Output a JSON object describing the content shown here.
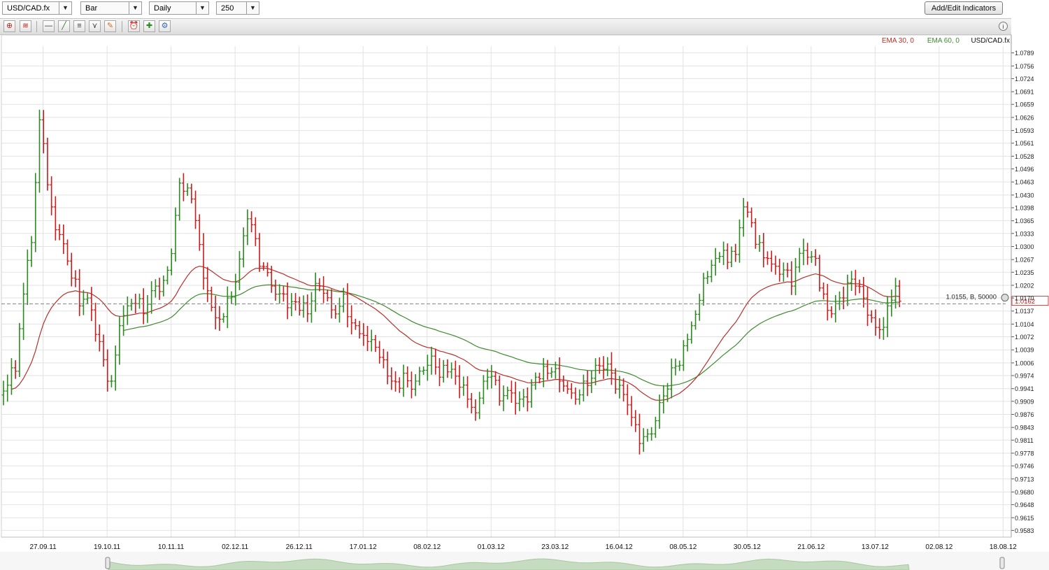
{
  "toolbar": {
    "symbol": "USD/CAD.fx",
    "chart_style": "Bar",
    "period": "Daily",
    "bars": "250",
    "add_indicators_label": "Add/Edit Indicators",
    "tools": [
      "crosshair-icon",
      "chart-type-icon",
      "horizontal-line-icon",
      "trend-line-icon",
      "fibonacci-icon",
      "pitchfork-icon",
      "eraser-icon",
      "alarm-clock-icon",
      "add-order-icon",
      "settings-gear-icon"
    ]
  },
  "legend": {
    "ema30": "EMA 30, 0",
    "ema60": "EMA 60, 0",
    "symbol": "USD/CAD.fx"
  },
  "colors": {
    "up": "#2a8a1e",
    "down": "#cc1b1b",
    "ema30": "#b8302a",
    "ema60": "#3d8b2f",
    "grid": "#e2e2e2",
    "position_line": "#888888",
    "price_label_bg": "#ffffff",
    "price_label_text": "#cc1b1b"
  },
  "position": {
    "label": "1.0155, B, 50000",
    "price": 1.0155
  },
  "current_price_label": "1.0162",
  "chart_data": {
    "type": "ohlc-bar",
    "title": "",
    "ylim": [
      0.9566,
      1.0806
    ],
    "y_ticks": [
      "1.0789",
      "1.0756",
      "1.0724",
      "1.0691",
      "1.0659",
      "1.0626",
      "1.0593",
      "1.0561",
      "1.0528",
      "1.0496",
      "1.0463",
      "1.0430",
      "1.0398",
      "1.0365",
      "1.0333",
      "1.0300",
      "1.0267",
      "1.0235",
      "1.0202",
      "1.0170",
      "1.0137",
      "1.0104",
      "1.0072",
      "1.0039",
      "1.0006",
      "0.9974",
      "0.9941",
      "0.9909",
      "0.9876",
      "0.9843",
      "0.9811",
      "0.9778",
      "0.9746",
      "0.9713",
      "0.9680",
      "0.9648",
      "0.9615",
      "0.9583"
    ],
    "x_ticks": [
      "27.09.11",
      "19.10.11",
      "10.11.11",
      "02.12.11",
      "26.12.11",
      "17.01.12",
      "08.02.12",
      "01.03.12",
      "23.03.12",
      "16.04.12",
      "08.05.12",
      "30.05.12",
      "21.06.12",
      "13.07.12",
      "02.08.12",
      "18.08.12"
    ],
    "x_tick_bar_index": [
      5,
      21,
      37,
      53,
      69,
      85,
      101,
      117,
      133,
      149,
      165,
      181,
      197,
      213,
      229,
      245
    ],
    "grid": true,
    "series": [
      {
        "name": "EMA 30, 0",
        "color": "#b8302a"
      },
      {
        "name": "EMA 60, 0",
        "color": "#3d8b2f"
      }
    ],
    "anchors": [
      [
        0,
        0.9935
      ],
      [
        3,
        0.9985
      ],
      [
        5,
        1.018
      ],
      [
        7,
        1.031
      ],
      [
        9,
        1.062
      ],
      [
        10,
        1.056
      ],
      [
        12,
        1.04
      ],
      [
        14,
        1.033
      ],
      [
        17,
        1.022
      ],
      [
        19,
        1.015
      ],
      [
        21,
        1.017
      ],
      [
        24,
        1.006
      ],
      [
        27,
        0.996
      ],
      [
        29,
        1.01
      ],
      [
        31,
        1.015
      ],
      [
        35,
        1.013
      ],
      [
        38,
        1.02
      ],
      [
        41,
        1.024
      ],
      [
        44,
        1.046
      ],
      [
        47,
        1.042
      ],
      [
        50,
        1.022
      ],
      [
        53,
        1.012
      ],
      [
        56,
        1.017
      ],
      [
        58,
        1.021
      ],
      [
        61,
        1.037
      ],
      [
        64,
        1.025
      ],
      [
        67,
        1.02
      ],
      [
        70,
        1.018
      ],
      [
        73,
        1.016
      ],
      [
        76,
        1.013
      ],
      [
        79,
        1.02
      ],
      [
        82,
        1.014
      ],
      [
        85,
        1.018
      ],
      [
        88,
        1.01
      ],
      [
        91,
        1.006
      ],
      [
        94,
        1.002
      ],
      [
        97,
        0.996
      ],
      [
        100,
        0.998
      ],
      [
        103,
        0.996
      ],
      [
        106,
        1.0
      ],
      [
        109,
        0.997
      ],
      [
        112,
        0.999
      ],
      [
        115,
        0.995
      ],
      [
        118,
        0.988
      ],
      [
        121,
        0.997
      ],
      [
        124,
        0.991
      ],
      [
        127,
        0.993
      ],
      [
        130,
        0.992
      ],
      [
        133,
        0.997
      ],
      [
        136,
        0.998
      ],
      [
        139,
        0.996
      ],
      [
        142,
        0.993
      ],
      [
        145,
        0.996
      ],
      [
        148,
        1.0
      ],
      [
        150,
        0.999
      ],
      [
        153,
        0.994
      ],
      [
        156,
        0.99
      ],
      [
        158,
        0.985
      ],
      [
        160,
        0.982
      ],
      [
        163,
        0.986
      ],
      [
        166,
        0.994
      ],
      [
        169,
        1.0
      ],
      [
        172,
        1.01
      ],
      [
        175,
        1.022
      ],
      [
        178,
        1.027
      ],
      [
        181,
        1.026
      ],
      [
        183,
        1.028
      ],
      [
        185,
        1.04
      ],
      [
        187,
        1.036
      ],
      [
        189,
        1.031
      ],
      [
        191,
        1.027
      ],
      [
        194,
        1.023
      ],
      [
        197,
        1.02
      ],
      [
        200,
        1.029
      ],
      [
        203,
        1.027
      ],
      [
        205,
        1.018
      ],
      [
        207,
        1.013
      ],
      [
        210,
        1.017
      ],
      [
        213,
        1.02
      ],
      [
        215,
        1.017
      ],
      [
        217,
        1.012
      ],
      [
        219,
        1.009
      ],
      [
        221,
        1.015
      ],
      [
        223,
        1.02
      ],
      [
        224,
        1.0162
      ]
    ]
  }
}
